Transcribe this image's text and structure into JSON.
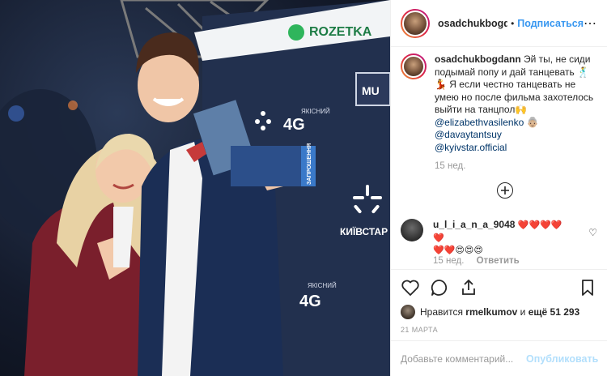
{
  "post": {
    "username": "osadchukbogdann",
    "header_username": "osadchukbogdar",
    "follow_label": "Подписаться",
    "more_icon": "more-horizontal-icon",
    "caption_text": "Эй ты, не сиди подымай попу и дай танцевать 🕺💃 Я если честно танцевать не умею но после фильма захотелось выйти на танцпол🙌",
    "mentions": [
      "@elizabethvasilenko 👵🏼",
      "@davaytantsuy",
      "@kyivstar.official"
    ],
    "caption_time": "15 нед.",
    "load_more_icon": "plus-circle-icon"
  },
  "comment": {
    "username": "u_l_i_a_n_a_9048",
    "text_line1": "❤️❤️❤️❤️❤️",
    "text_line2": "❤️❤️😍😍😍",
    "time": "15 нед.",
    "reply_label": "Ответить"
  },
  "likes": {
    "prefix": "Нравится",
    "user": "rmelkumov",
    "middle": "и",
    "count": "ещё 51 293"
  },
  "date": "21 МАРТА",
  "add_comment": {
    "placeholder": "Добавьте комментарий...",
    "publish_label": "Опубликовать"
  },
  "photo": {
    "sign_rozetka": "ROZETKA",
    "sign_4g": "4G",
    "sign_4g_small": "ЯКІСНИЙ",
    "sign_kyivstar": "КИЇВСТАР",
    "ticket_label": "ЗАПРОШЕННЯ",
    "sign_mu": "MU"
  },
  "colors": {
    "link_blue": "#3897f0",
    "mention_blue": "#003569",
    "muted_gray": "#999999",
    "publish_disabled": "#b2dffc",
    "backdrop_navy": "#1f2a44"
  }
}
